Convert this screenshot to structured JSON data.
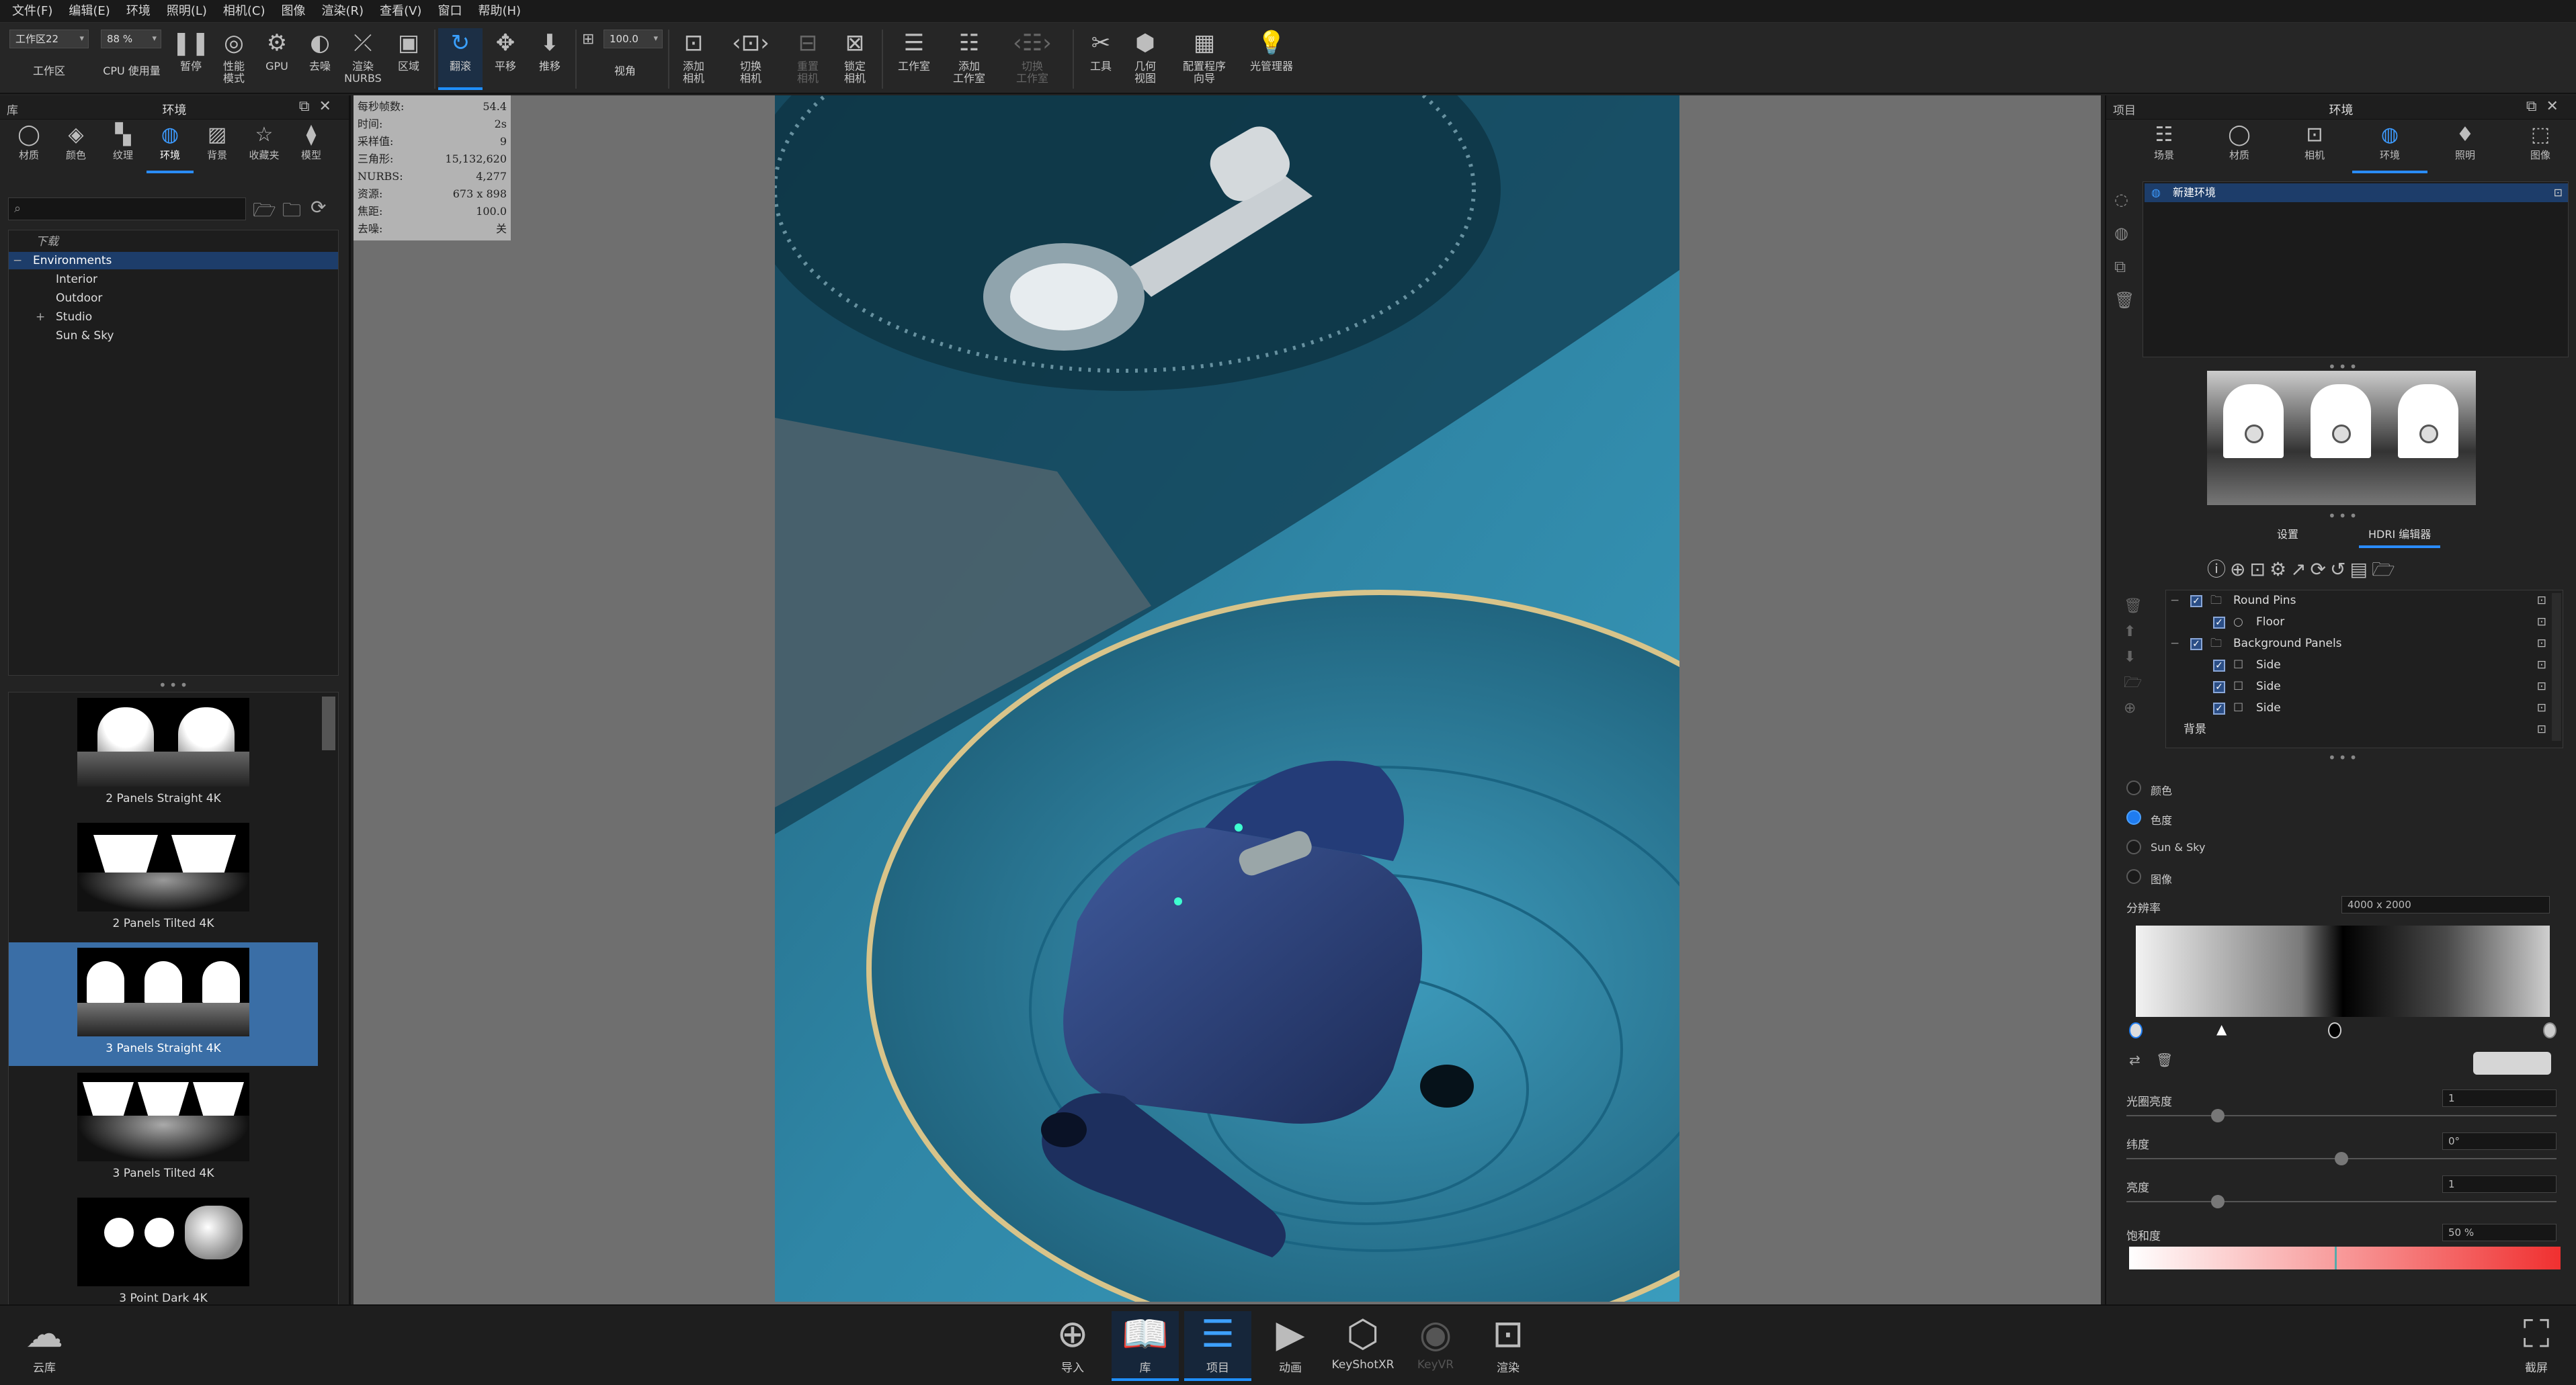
{
  "menu": [
    "文件(F)",
    "编辑(E)",
    "环境",
    "照明(L)",
    "相机(C)",
    "图像",
    "渲染(R)",
    "查看(V)",
    "窗口",
    "帮助(H)"
  ],
  "toolbar": {
    "workspace_value": "工作区22",
    "workspace_label": "工作区",
    "cpu_value": "88 %",
    "cpu_label": "CPU 使用量",
    "pause": "暂停",
    "perf": "性能\n模式",
    "gpu": "GPU",
    "denoise": "去噪",
    "render_nurbs": "渲染\nNURBS",
    "region": "区域",
    "tumble": "翻滚",
    "pan": "平移",
    "dolly": "推移",
    "fov_value": "100.0",
    "fov_label": "视角",
    "add_camera": "添加\n相机",
    "switch_camera": "切换\n相机",
    "reset_camera": "重置\n相机",
    "lock_camera": "锁定\n相机",
    "studio": "工作室",
    "add_studio": "添加\n工作室",
    "switch_studio": "切换\n工作室",
    "tools": "工具",
    "geometry_view": "几何\n视图",
    "config_wizard": "配置程序\n向导",
    "light_manager": "光管理器"
  },
  "left": {
    "panel_label": "库",
    "title": "环境",
    "tabs": [
      {
        "icon": "material-icon",
        "label": "材质"
      },
      {
        "icon": "color-icon",
        "label": "颜色"
      },
      {
        "icon": "texture-icon",
        "label": "纹理"
      },
      {
        "icon": "environment-icon",
        "label": "环境"
      },
      {
        "icon": "background-icon",
        "label": "背景"
      },
      {
        "icon": "favorites-icon",
        "label": "收藏夹"
      },
      {
        "icon": "model-icon",
        "label": "模型"
      }
    ],
    "tree": [
      "下载",
      "Environments",
      "Interior",
      "Outdoor",
      "Studio",
      "Sun & Sky"
    ],
    "thumbs": [
      "2 Panels Straight 4K",
      "2 Panels Tilted 4K",
      "3 Panels Straight 4K",
      "3 Panels Tilted 4K",
      "3 Point Dark 4K"
    ]
  },
  "stats": [
    {
      "k": "每秒帧数:",
      "v": "54.4"
    },
    {
      "k": "时间:",
      "v": "2s"
    },
    {
      "k": "采样值:",
      "v": "9"
    },
    {
      "k": "三角形:",
      "v": "15,132,620"
    },
    {
      "k": "NURBS:",
      "v": "4,277"
    },
    {
      "k": "资源:",
      "v": "673 x 898"
    },
    {
      "k": "焦距:",
      "v": "100.0"
    },
    {
      "k": "去噪:",
      "v": "关"
    }
  ],
  "right": {
    "panel_label": "项目",
    "title": "环境",
    "tabs": [
      {
        "label": "场景"
      },
      {
        "label": "材质"
      },
      {
        "label": "相机"
      },
      {
        "label": "环境"
      },
      {
        "label": "照明"
      },
      {
        "label": "图像"
      }
    ],
    "env_item": "新建环境",
    "subtabs": [
      "设置",
      "HDRI 编辑器"
    ],
    "layers": [
      "Round Pins",
      "Floor",
      "Background Panels",
      "Side",
      "Side",
      "Side",
      "背景"
    ],
    "bg_options": [
      "颜色",
      "色度",
      "Sun & Sky",
      "图像"
    ],
    "resolution_label": "分辨率",
    "resolution_value": "4000 x 2000",
    "props": [
      {
        "label": "光圈亮度",
        "value": "1"
      },
      {
        "label": "纬度",
        "value": "0°"
      },
      {
        "label": "亮度",
        "value": "1"
      },
      {
        "label": "饱和度",
        "value": "50 %"
      }
    ]
  },
  "bottom": [
    "导入",
    "库",
    "项目",
    "动画",
    "KeyShotXR",
    "KeyVR",
    "渲染"
  ],
  "cloud": "云库",
  "screenshot": "截屏",
  "colors": {
    "accent": "#1f8fff",
    "selected": "#1d3d6a",
    "render_bg": "#2a6f8a"
  }
}
